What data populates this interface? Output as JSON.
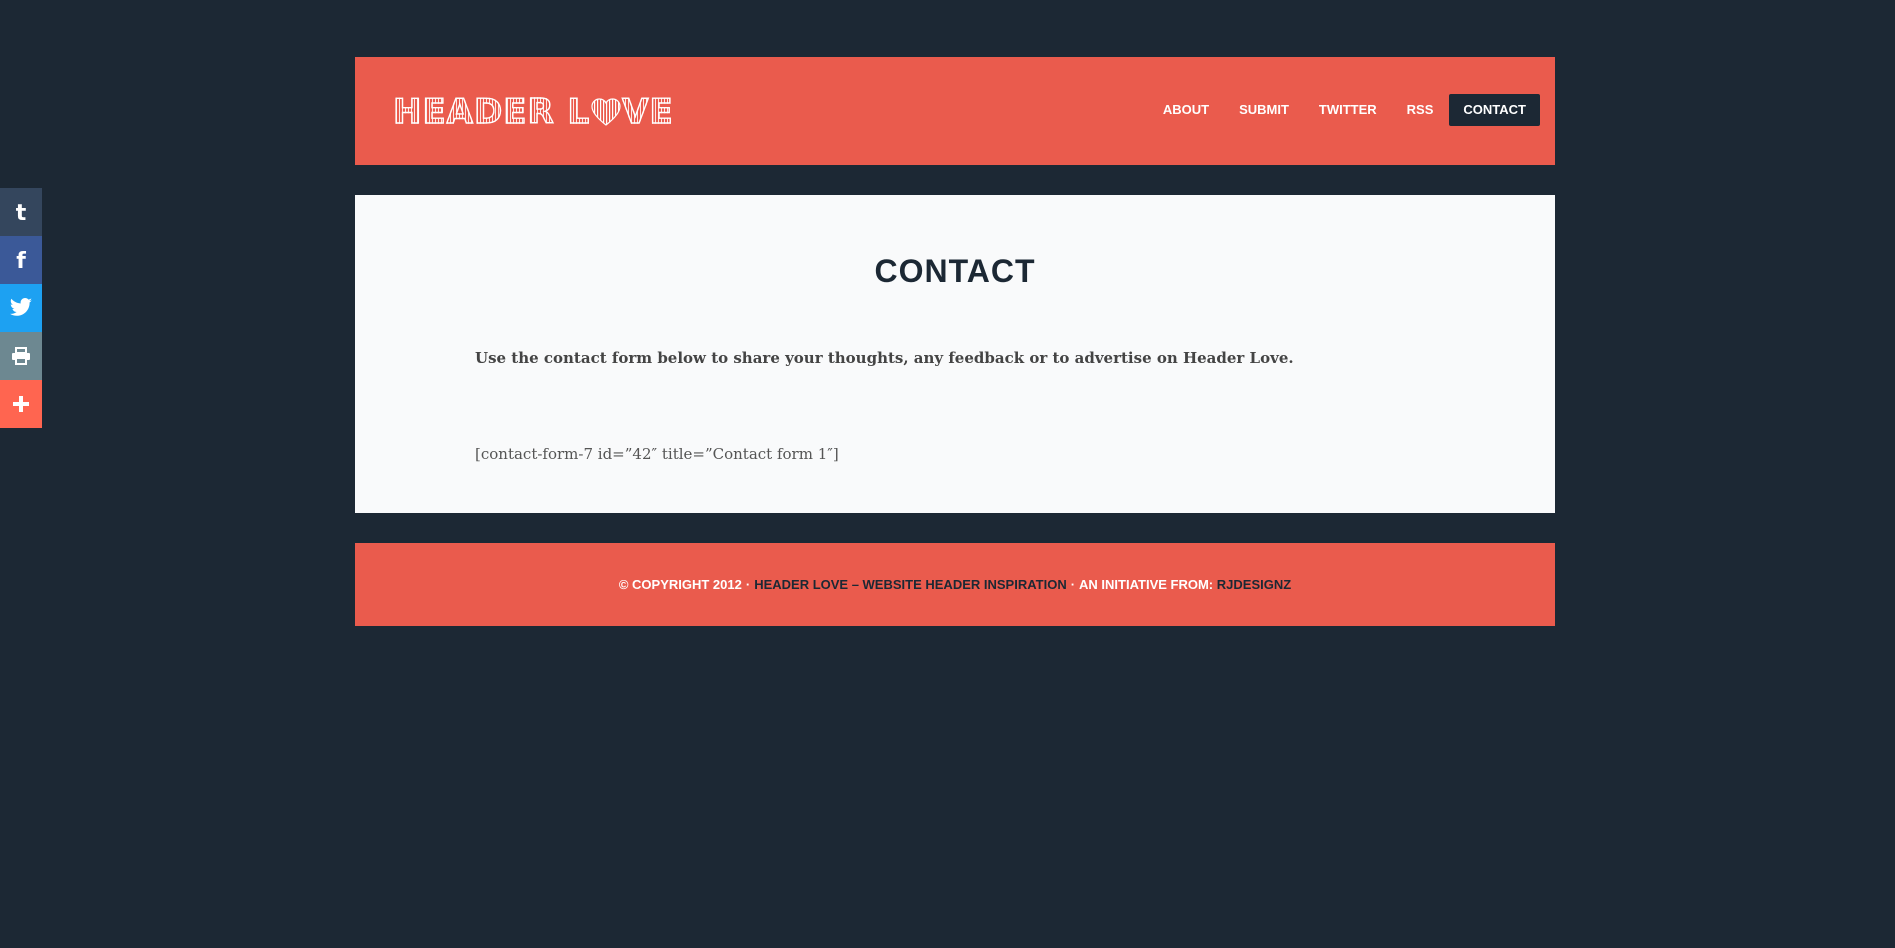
{
  "colors": {
    "background": "#1c2834",
    "brand_red": "#ea5b4d",
    "content_bg": "#f9fafb",
    "text_dark": "#1c2834"
  },
  "share_bar": [
    {
      "name": "tumblr",
      "icon": "tumblr-icon",
      "color": "#34465d"
    },
    {
      "name": "facebook",
      "icon": "facebook-icon",
      "color": "#3b5998"
    },
    {
      "name": "twitter",
      "icon": "twitter-icon",
      "color": "#1da1f2"
    },
    {
      "name": "print",
      "icon": "print-icon",
      "color": "#6d8891"
    },
    {
      "name": "more",
      "icon": "plus-icon",
      "color": "#ff6550"
    }
  ],
  "header": {
    "logo": {
      "part1": "HEADER L",
      "part2": "VE",
      "icon": "heart-icon"
    },
    "nav": [
      {
        "label": "ABOUT",
        "active": false
      },
      {
        "label": "SUBMIT",
        "active": false
      },
      {
        "label": "TWITTER",
        "active": false
      },
      {
        "label": "RSS",
        "active": false
      },
      {
        "label": "CONTACT",
        "active": true
      }
    ]
  },
  "main": {
    "title": "CONTACT",
    "intro": "Use the contact form below to share your thoughts, any feedback or to advertise on Header Love.",
    "shortcode": "[contact-form-7 id=”42″ title=”Contact form 1″]"
  },
  "footer": {
    "copyright": "© COPYRIGHT 2012",
    "separator": "·",
    "site_link": "HEADER LOVE – WEBSITE HEADER INSPIRATION",
    "initiative": "AN INITIATIVE FROM:",
    "author_link": "RJDESIGNZ"
  }
}
